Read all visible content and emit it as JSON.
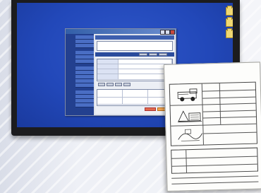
{
  "app": {
    "window_title": "",
    "panel_title": "",
    "side_groups": [
      {
        "head": "",
        "items": 3
      },
      {
        "head": "",
        "items": 3
      },
      {
        "head": "",
        "items": 5
      },
      {
        "head": "",
        "items": 4
      }
    ]
  },
  "paper": {
    "title": "",
    "subtitle": "",
    "document_id": ""
  },
  "colors": {
    "desktop": "#2248b9",
    "sidebar": "#23408f",
    "panel_header": "#3d5fae",
    "alert_button": "#e06a4d",
    "warn_button": "#f2a654"
  },
  "icons": [
    "folder-icon",
    "folder-icon",
    "folder-icon"
  ]
}
